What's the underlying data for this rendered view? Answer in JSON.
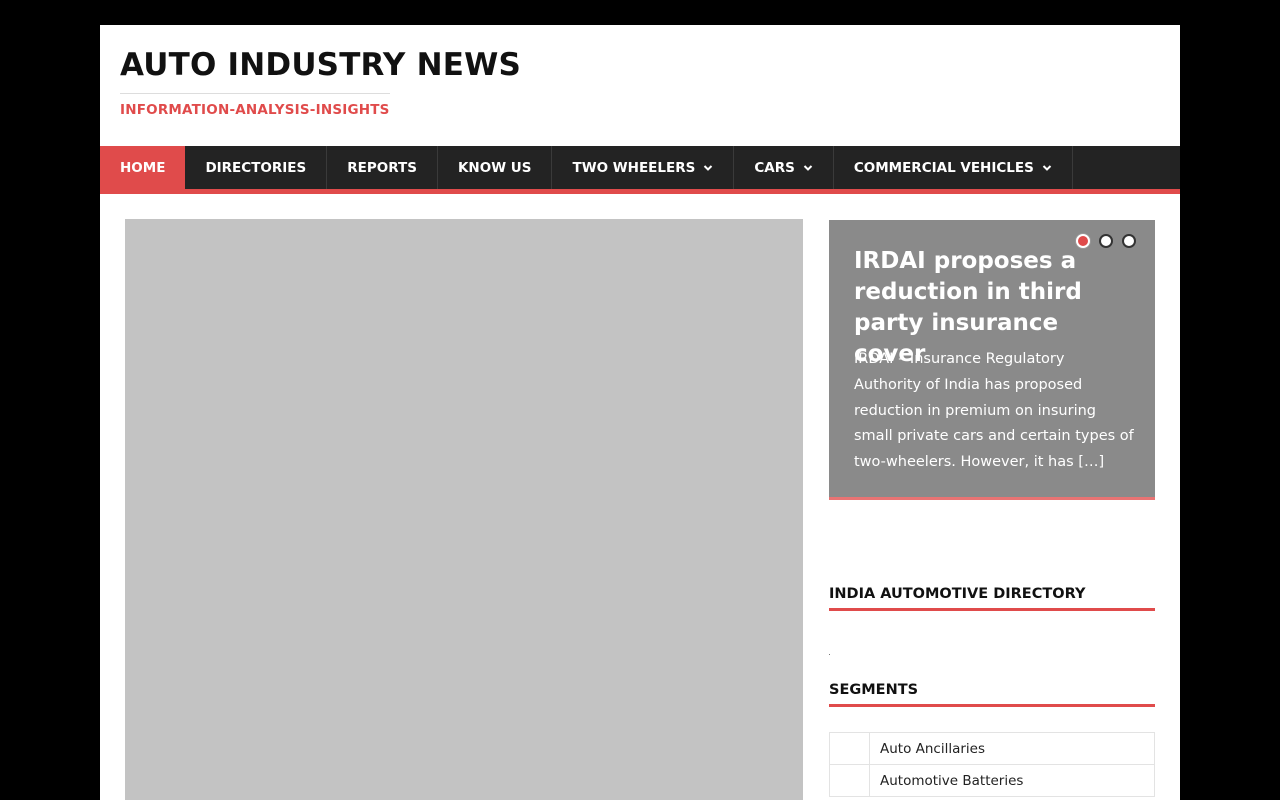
{
  "site": {
    "title": "AUTO INDUSTRY NEWS",
    "tagline": "INFORMATION-ANALYSIS-INSIGHTS"
  },
  "nav": {
    "items": [
      {
        "label": "HOME",
        "active": true,
        "has_dropdown": false
      },
      {
        "label": "DIRECTORIES",
        "has_dropdown": false
      },
      {
        "label": "REPORTS",
        "has_dropdown": false
      },
      {
        "label": "KNOW US",
        "has_dropdown": false
      },
      {
        "label": "TWO WHEELERS",
        "has_dropdown": true
      },
      {
        "label": "CARS",
        "has_dropdown": true
      },
      {
        "label": "COMMERCIAL VEHICLES",
        "has_dropdown": true
      }
    ]
  },
  "slider": {
    "title": "IRDAI proposes a reduction in third party insurance cover",
    "excerpt": "IRDAI – Insurance Regulatory Authority of India has proposed reduction in premium on insuring small private cars and certain types of two-wheelers. However, it has […]",
    "active_slide": 1,
    "slide_count": 3
  },
  "widgets": {
    "directory_title": "INDIA AUTOMOTIVE DIRECTORY",
    "segments_title": "SEGMENTS",
    "segments": [
      "Auto Ancillaries",
      "Automotive Batteries"
    ]
  },
  "colors": {
    "accent": "#e04b4b",
    "nav_bg": "#232323",
    "slider_bg": "#8a8a8a",
    "placeholder_bg": "#c3c3c3"
  }
}
